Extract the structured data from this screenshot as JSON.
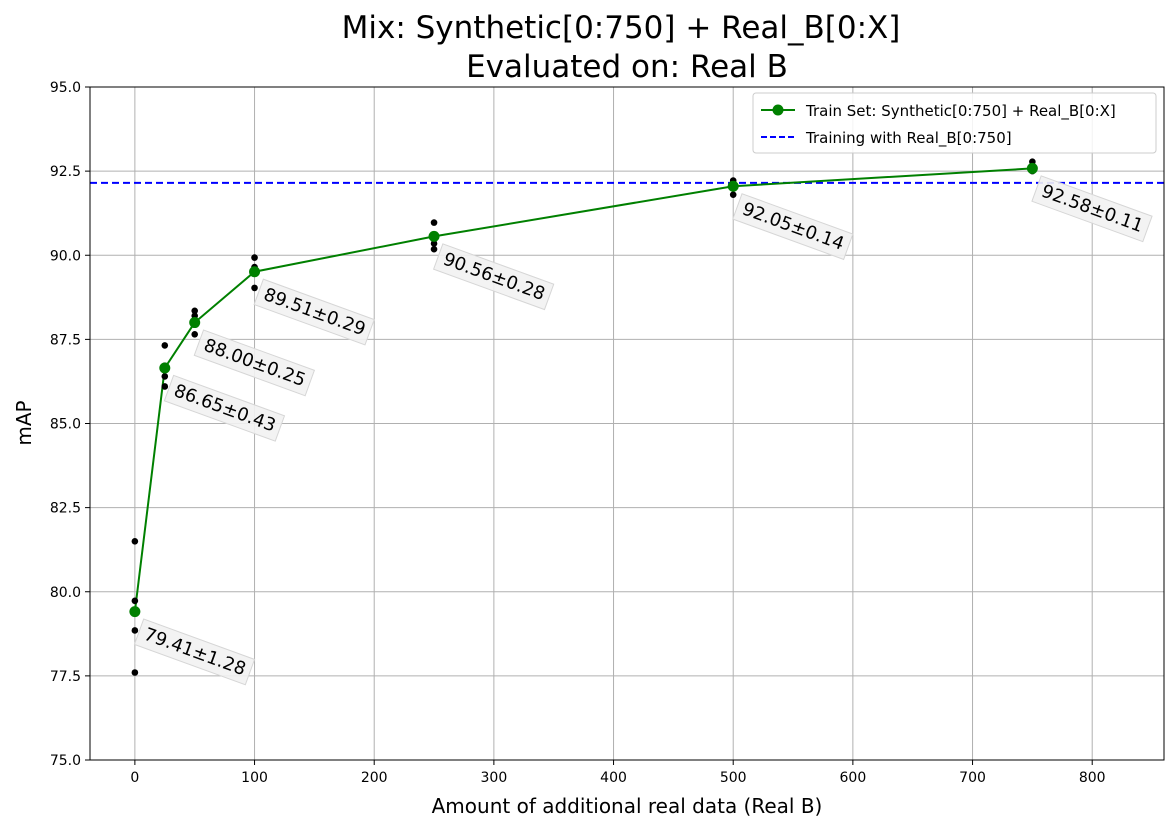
{
  "chart_data": {
    "type": "line",
    "title": [
      "Mix: Synthetic[0:750] + Real_B[0:X]",
      "Evaluated on: Real B"
    ],
    "xlabel": "Amount of additional real data (Real B)",
    "ylabel": "mAP",
    "xlim": [
      -37.5,
      860
    ],
    "ylim": [
      75,
      95
    ],
    "xticks": [
      0,
      100,
      200,
      300,
      400,
      500,
      600,
      700,
      800
    ],
    "yticks": [
      75.0,
      77.5,
      80.0,
      82.5,
      85.0,
      87.5,
      90.0,
      92.5,
      95.0
    ],
    "xtick_labels": [
      "0",
      "100",
      "200",
      "300",
      "400",
      "500",
      "600",
      "700",
      "800"
    ],
    "ytick_labels": [
      "75.0",
      "77.5",
      "80.0",
      "82.5",
      "85.0",
      "87.5",
      "90.0",
      "92.5",
      "95.0"
    ],
    "grid": true,
    "legend_position": "top-right",
    "series": [
      {
        "name": "Train Set: Synthetic[0:750] + Real_B[0:X]",
        "color": "#008000",
        "style": "solid-with-markers",
        "x": [
          0,
          25,
          50,
          100,
          250,
          500,
          750
        ],
        "y": [
          79.41,
          86.65,
          88.0,
          89.51,
          90.56,
          92.05,
          92.58
        ]
      }
    ],
    "reference_lines": [
      {
        "name": "Training with Real_B[0:750]",
        "color": "#0000ff",
        "style": "dashed",
        "y": 92.15
      }
    ],
    "individual_runs": {
      "color": "#000000",
      "points": [
        {
          "x": 0,
          "y": 81.5
        },
        {
          "x": 0,
          "y": 79.73
        },
        {
          "x": 0,
          "y": 78.85
        },
        {
          "x": 0,
          "y": 77.6
        },
        {
          "x": 25,
          "y": 87.32
        },
        {
          "x": 25,
          "y": 86.72
        },
        {
          "x": 25,
          "y": 86.4
        },
        {
          "x": 25,
          "y": 86.1
        },
        {
          "x": 50,
          "y": 88.35
        },
        {
          "x": 50,
          "y": 88.2
        },
        {
          "x": 50,
          "y": 87.65
        },
        {
          "x": 100,
          "y": 89.93
        },
        {
          "x": 100,
          "y": 89.65
        },
        {
          "x": 100,
          "y": 89.03
        },
        {
          "x": 250,
          "y": 90.97
        },
        {
          "x": 250,
          "y": 90.35
        },
        {
          "x": 250,
          "y": 90.18
        },
        {
          "x": 500,
          "y": 92.22
        },
        {
          "x": 500,
          "y": 91.8
        },
        {
          "x": 750,
          "y": 92.78
        },
        {
          "x": 750,
          "y": 92.5
        }
      ]
    },
    "annotations": [
      "79.41±1.28",
      "86.65±0.43",
      "88.00±0.25",
      "89.51±0.29",
      "90.56±0.28",
      "92.05±0.14",
      "92.58±0.11"
    ]
  }
}
